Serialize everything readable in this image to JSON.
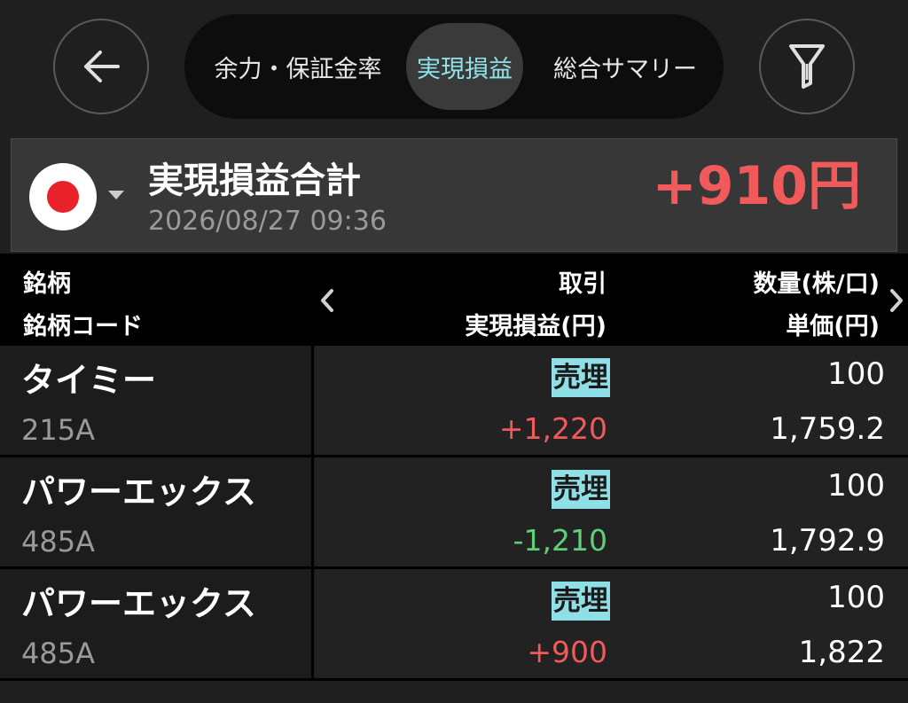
{
  "nav": {
    "back_icon": "arrow-left-icon",
    "filter_icon": "filter-icon",
    "tabs": [
      {
        "label": "余力・保証金率",
        "active": false
      },
      {
        "label": "実現損益",
        "active": true
      },
      {
        "label": "総合サマリー",
        "active": false
      }
    ]
  },
  "summary": {
    "flag_icon": "japan-flag-icon",
    "title": "実現損益合計",
    "timestamp": "2026/08/27 09:36",
    "total": "+910円"
  },
  "table": {
    "headers": {
      "name": "銘柄",
      "code": "銘柄コード",
      "trade": "取引",
      "pnl": "実現損益(円)",
      "quantity": "数量(株/口)",
      "unit_price": "単価(円)"
    },
    "rows": [
      {
        "name": "タイミー",
        "code": "215A",
        "trade": "売埋",
        "pnl": "+1,220",
        "pnl_sign": "pos",
        "quantity": "100",
        "unit_price": "1,759.2"
      },
      {
        "name": "パワーエックス",
        "code": "485A",
        "trade": "売埋",
        "pnl": "-1,210",
        "pnl_sign": "neg",
        "quantity": "100",
        "unit_price": "1,792.9"
      },
      {
        "name": "パワーエックス",
        "code": "485A",
        "trade": "売埋",
        "pnl": "+900",
        "pnl_sign": "pos",
        "quantity": "100",
        "unit_price": "1,822"
      }
    ]
  },
  "colors": {
    "positive": "#f05a5a",
    "negative": "#5fd07a",
    "accent": "#8fe3e8",
    "badge": "#8fe0e6"
  }
}
